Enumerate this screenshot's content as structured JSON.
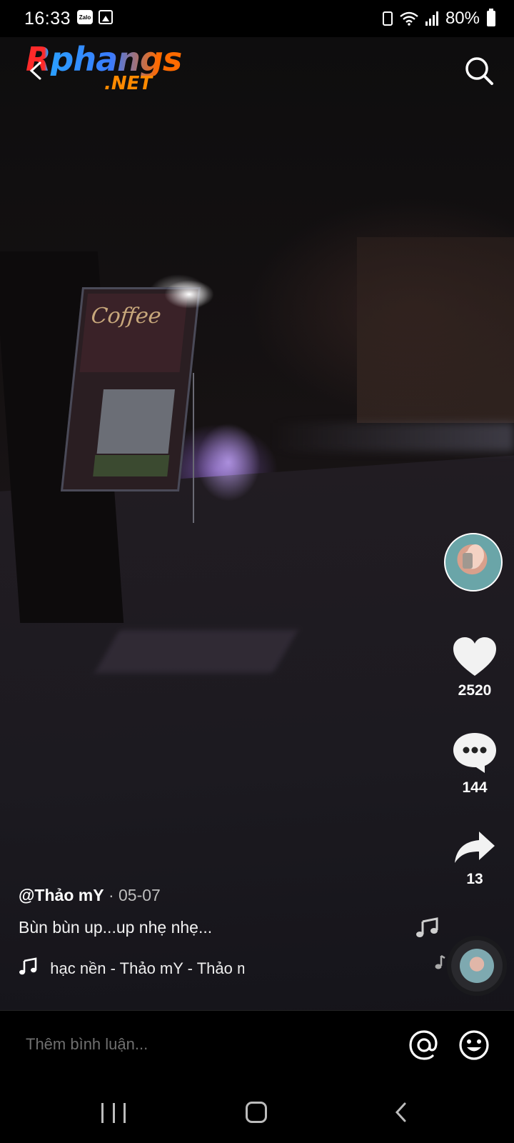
{
  "status_bar": {
    "time": "16:33",
    "zalo_label": "Zalo",
    "battery_text": "80%"
  },
  "watermark": {
    "line1": "Rphangs",
    "line2": ".NET"
  },
  "video": {
    "sign_text": "Coffee"
  },
  "actions": {
    "likes": "2520",
    "comments": "144",
    "shares": "13"
  },
  "caption": {
    "username": "@Thảo mY",
    "date": " · 05-07",
    "description": "Bùn bùn up...up nhẹ nhẹ...",
    "music": "nhạc nền - Thảo mY - Thảo mY"
  },
  "comment_bar": {
    "placeholder": "Thêm bình luận..."
  },
  "icons": {
    "back": "back-arrow-icon",
    "search": "search-icon",
    "like": "heart-icon",
    "comment": "comment-bubble-icon",
    "share": "share-arrow-icon",
    "mention": "at-icon",
    "emoji": "smile-icon"
  }
}
